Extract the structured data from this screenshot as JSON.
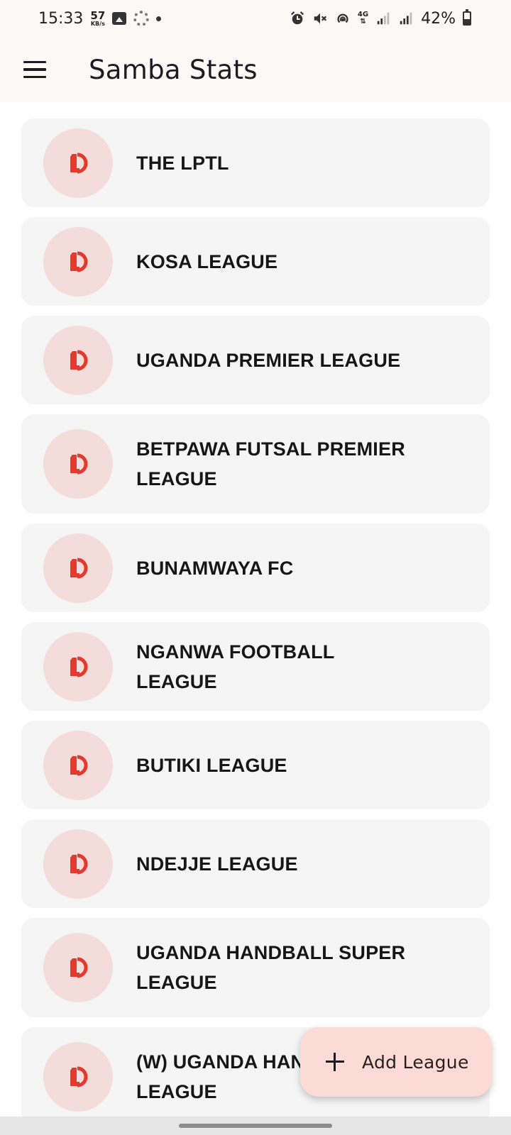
{
  "status_bar": {
    "time": "15:33",
    "speed_value": "57",
    "speed_unit": "KB/s",
    "network": "4G",
    "battery": "42%"
  },
  "app_bar": {
    "title": "Samba Stats",
    "menu_icon": "menu-icon"
  },
  "leagues": [
    {
      "name": "THE LPTL",
      "icon": "league-logo-icon"
    },
    {
      "name": "KOSA LEAGUE",
      "icon": "league-logo-icon"
    },
    {
      "name": "UGANDA PREMIER LEAGUE",
      "icon": "league-logo-icon"
    },
    {
      "name": "BETPAWA FUTSAL PREMIER LEAGUE",
      "icon": "league-logo-icon"
    },
    {
      "name": "BUNAMWAYA FC",
      "icon": "league-logo-icon"
    },
    {
      "name": "NGANWA FOOTBALL LEAGUE",
      "icon": "league-logo-icon"
    },
    {
      "name": "BUTIKI LEAGUE",
      "icon": "league-logo-icon"
    },
    {
      "name": "NDEJJE LEAGUE",
      "icon": "league-logo-icon"
    },
    {
      "name": "UGANDA HANDBALL SUPER LEAGUE",
      "icon": "league-logo-icon"
    },
    {
      "name": "(W) UGANDA HANDBALL LEAGUE",
      "icon": "league-logo-icon"
    }
  ],
  "fab": {
    "label": "Add League",
    "icon": "plus-icon"
  },
  "colors": {
    "logo_red": "#e5392d",
    "logo_bg": "#f3dcda",
    "card_bg": "#f5f5f5",
    "fab_bg": "#fcdad5"
  }
}
